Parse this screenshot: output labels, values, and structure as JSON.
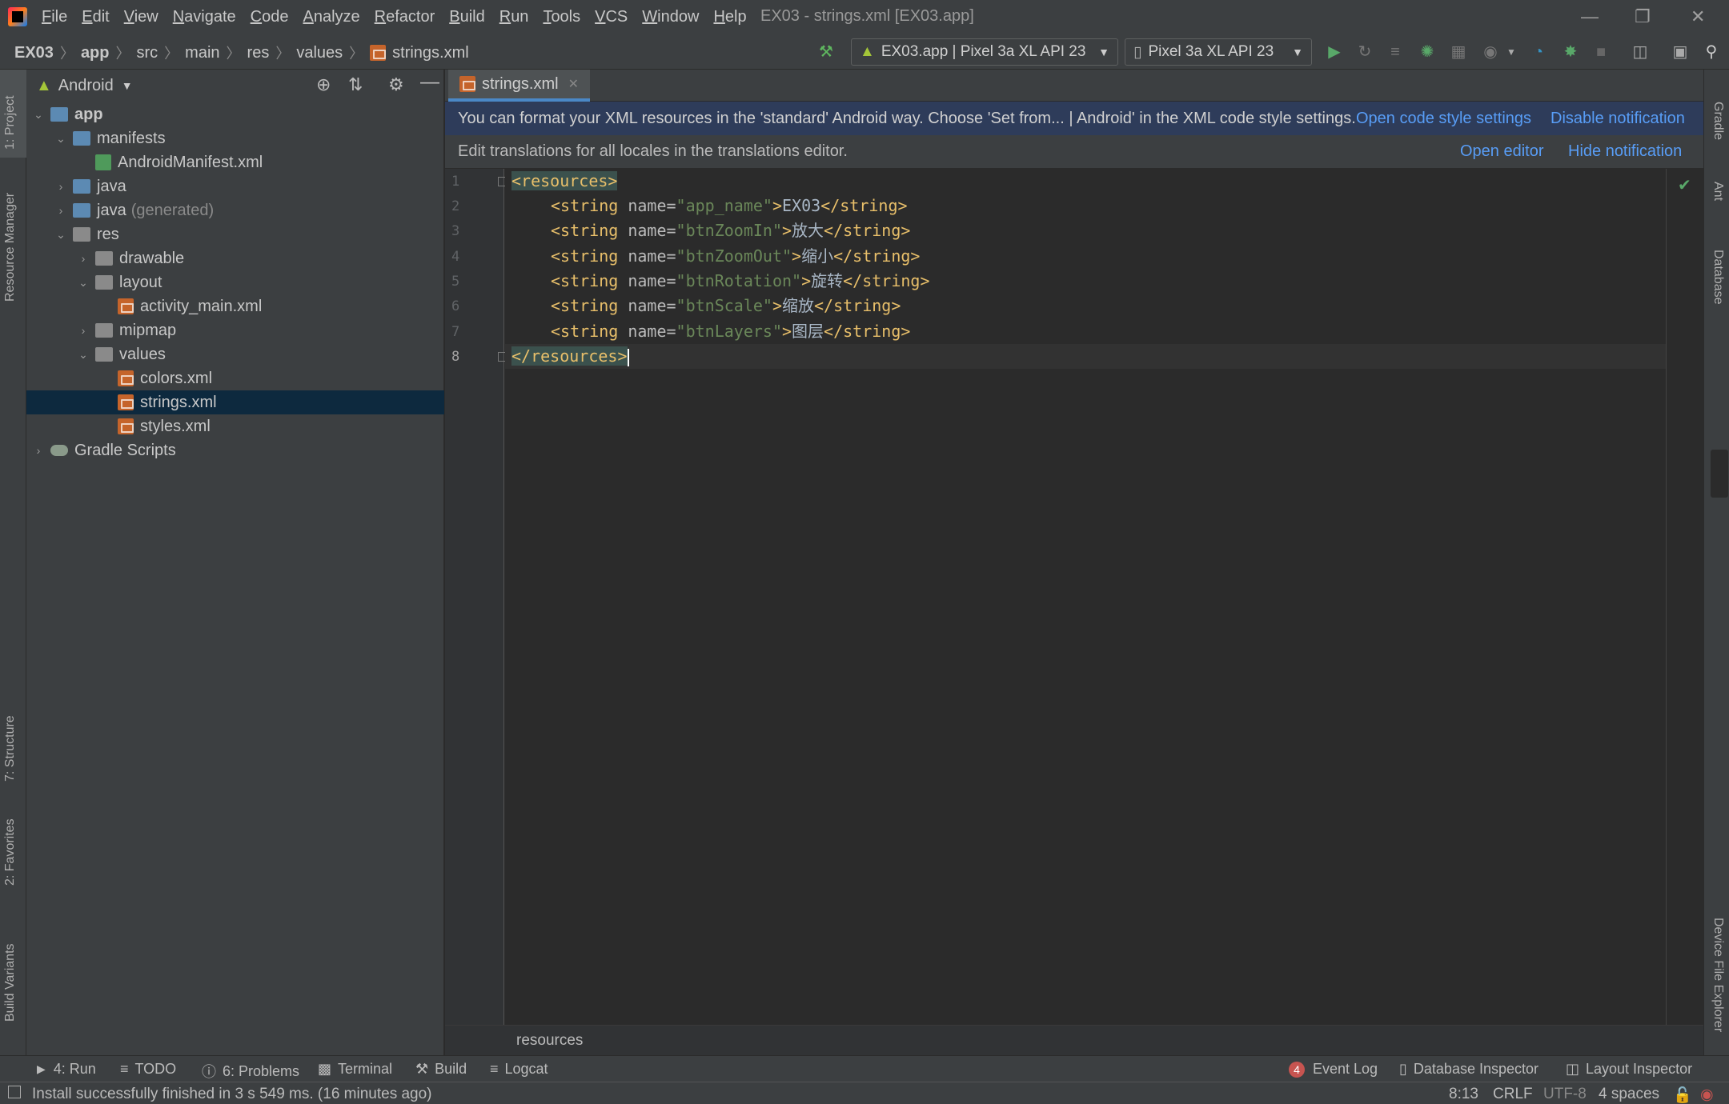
{
  "menu": [
    "File",
    "Edit",
    "View",
    "Navigate",
    "Code",
    "Analyze",
    "Refactor",
    "Build",
    "Run",
    "Tools",
    "VCS",
    "Window",
    "Help"
  ],
  "window_title": "EX03 - strings.xml [EX03.app]",
  "breadcrumb": [
    "EX03",
    "app",
    "src",
    "main",
    "res",
    "values",
    "strings.xml"
  ],
  "run_config": "EX03.app | Pixel 3a XL API 23",
  "device": "Pixel 3a XL API 23",
  "left_tools": {
    "project": "1: Project",
    "resource_manager": "Resource Manager",
    "structure": "7: Structure",
    "favorites": "2: Favorites",
    "build_variants": "Build Variants"
  },
  "right_tools": {
    "gradle": "Gradle",
    "ant": "Ant",
    "database": "Database",
    "device_file_explorer": "Device File Explorer"
  },
  "project": {
    "view_mode": "Android",
    "tree": {
      "app": "app",
      "manifests": "manifests",
      "manifest_file": "AndroidManifest.xml",
      "java": "java",
      "java_gen": "java",
      "java_gen_suffix": "(generated)",
      "res": "res",
      "drawable": "drawable",
      "layout": "layout",
      "activity_main": "activity_main.xml",
      "mipmap": "mipmap",
      "values": "values",
      "colors": "colors.xml",
      "strings": "strings.xml",
      "styles": "styles.xml",
      "gradle_scripts": "Gradle Scripts"
    }
  },
  "editor": {
    "tab": "strings.xml",
    "notif1": {
      "text": "You can format your XML resources in the 'standard' Android way. Choose 'Set from... | Android' in the XML code style settings.",
      "link1": "Open code style settings",
      "link2": "Disable notification"
    },
    "notif2": {
      "text": "Edit translations for all locales in the translations editor.",
      "link1": "Open editor",
      "link2": "Hide notification"
    },
    "line_numbers": [
      "1",
      "2",
      "3",
      "4",
      "5",
      "6",
      "7",
      "8"
    ],
    "code": {
      "open": "<resources>",
      "close": "</resources>",
      "tag_open": "<string",
      "tag_close": "</string>",
      "attr": " name=",
      "rows": [
        {
          "name": "\"app_name\"",
          "value": "EX03"
        },
        {
          "name": "\"btnZoomIn\"",
          "value": "放大"
        },
        {
          "name": "\"btnZoomOut\"",
          "value": "缩小"
        },
        {
          "name": "\"btnRotation\"",
          "value": "旋转"
        },
        {
          "name": "\"btnScale\"",
          "value": "缩放"
        },
        {
          "name": "\"btnLayers\"",
          "value": "图层"
        }
      ]
    },
    "breadcrumb": "resources"
  },
  "bottom_tools": {
    "run": "4: Run",
    "todo": "TODO",
    "problems": "6: Problems",
    "terminal": "Terminal",
    "build": "Build",
    "logcat": "Logcat",
    "event_log": "Event Log",
    "event_count": "4",
    "db_inspector": "Database Inspector",
    "layout_inspector": "Layout Inspector"
  },
  "status": {
    "message": "Install successfully finished in 3 s 549 ms. (16 minutes ago)",
    "position": "8:13",
    "line_sep": "CRLF",
    "encoding": "UTF-8",
    "indent": "4 spaces"
  },
  "colors": {
    "accent": "#4a88c7",
    "selection": "#0d293e",
    "tag": "#e8bf6a",
    "string": "#6a8759",
    "link": "#589df6"
  }
}
